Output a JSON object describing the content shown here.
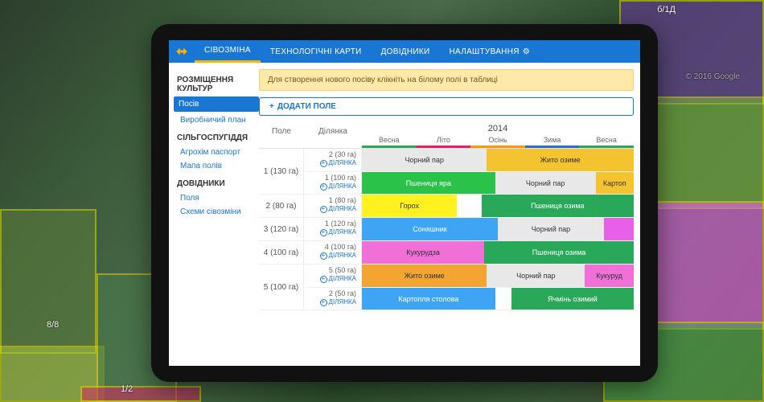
{
  "map": {
    "labels": {
      "l1": "8/8",
      "l2": "1/2",
      "l3": "б/1Д",
      "copyright": "© 2016 Google"
    }
  },
  "topnav": {
    "items": [
      {
        "label": "СІВОЗМІНА",
        "active": true
      },
      {
        "label": "ТЕХНОЛОГІЧНІ КАРТИ",
        "active": false
      },
      {
        "label": "ДОВІДНИКИ",
        "active": false
      },
      {
        "label": "НАЛАШТУВАННЯ",
        "active": false,
        "gear": true
      }
    ]
  },
  "sidebar": {
    "sections": [
      {
        "heading": "РОЗМІЩЕННЯ КУЛЬТУР",
        "items": [
          {
            "label": "Посів",
            "active": true
          },
          {
            "label": "Виробничий план"
          }
        ]
      },
      {
        "heading": "СІЛЬГОСПУГІДДЯ",
        "items": [
          {
            "label": "Агрохім паспорт"
          },
          {
            "label": "Мапа полів"
          }
        ]
      },
      {
        "heading": "ДОВІДНИКИ",
        "items": [
          {
            "label": "Поля"
          },
          {
            "label": "Схеми сівозміни"
          }
        ]
      }
    ]
  },
  "content": {
    "hint": "Для створення нового посіву клікніть на білому полі в таблиці",
    "add_button": "ДОДАТИ ПОЛЕ",
    "headers": {
      "field": "Поле",
      "plot": "Ділянка",
      "year": "2014"
    },
    "seasons": [
      "Весна",
      "Літо",
      "Осінь",
      "Зима",
      "Весна"
    ],
    "plot_action": "ДІЛЯНКА",
    "fields": [
      {
        "name": "1 (130 га)",
        "plots": [
          {
            "name": "2 (30 га)",
            "bars": [
              {
                "label": "Чорний пар",
                "color": "#e8e8e8",
                "start": 0,
                "span": 46
              },
              {
                "label": "Жито озиме",
                "color": "#f4c430",
                "start": 46,
                "span": 54
              }
            ]
          },
          {
            "name": "1 (100 га)",
            "bars": [
              {
                "label": "Пшениця яра",
                "color": "#2bc24a",
                "start": 0,
                "span": 49,
                "fg": "#fff"
              },
              {
                "label": "Чорний пар",
                "color": "#e8e8e8",
                "start": 49,
                "span": 37
              },
              {
                "label": "Картоп",
                "color": "#f4c430",
                "start": 86,
                "span": 14
              }
            ]
          }
        ]
      },
      {
        "name": "2 (80 га)",
        "plots": [
          {
            "name": "1 (80 га)",
            "bars": [
              {
                "label": "Горох",
                "color": "#fff020",
                "start": 0,
                "span": 35
              },
              {
                "label": "",
                "color": "transparent",
                "start": 35,
                "span": 9
              },
              {
                "label": "Пшениця озима",
                "color": "#2aa85a",
                "start": 44,
                "span": 56,
                "fg": "#fff"
              }
            ]
          }
        ]
      },
      {
        "name": "3 (120 га)",
        "plots": [
          {
            "name": "1 (120 га)",
            "bars": [
              {
                "label": "Соняшник",
                "color": "#3da5f4",
                "start": 0,
                "span": 50,
                "fg": "#fff"
              },
              {
                "label": "Чорний пар",
                "color": "#e8e8e8",
                "start": 50,
                "span": 39
              },
              {
                "label": "",
                "color": "#e860e8",
                "start": 89,
                "span": 11
              }
            ]
          }
        ]
      },
      {
        "name": "4 (100 га)",
        "plots": [
          {
            "name": "4 (100 га)",
            "bars": [
              {
                "label": "Кукурудза",
                "color": "#f070d8",
                "start": 0,
                "span": 45
              },
              {
                "label": "Пшениця озима",
                "color": "#2aa85a",
                "start": 45,
                "span": 55,
                "fg": "#fff"
              }
            ]
          }
        ]
      },
      {
        "name": "5 (100 га)",
        "plots": [
          {
            "name": "5 (50 га)",
            "bars": [
              {
                "label": "Жито озиме",
                "color": "#f4a430",
                "start": 0,
                "span": 46
              },
              {
                "label": "Чорний пар",
                "color": "#e8e8e8",
                "start": 46,
                "span": 36
              },
              {
                "label": "Кукуруд",
                "color": "#f070d8",
                "start": 82,
                "span": 18
              }
            ]
          },
          {
            "name": "2 (50 га)",
            "bars": [
              {
                "label": "Картопля столова",
                "color": "#3da5f4",
                "start": 0,
                "span": 49,
                "fg": "#fff"
              },
              {
                "label": "",
                "color": "transparent",
                "start": 49,
                "span": 6
              },
              {
                "label": "Ячмінь озимий",
                "color": "#2aa85a",
                "start": 55,
                "span": 45,
                "fg": "#fff"
              }
            ]
          }
        ]
      }
    ]
  }
}
